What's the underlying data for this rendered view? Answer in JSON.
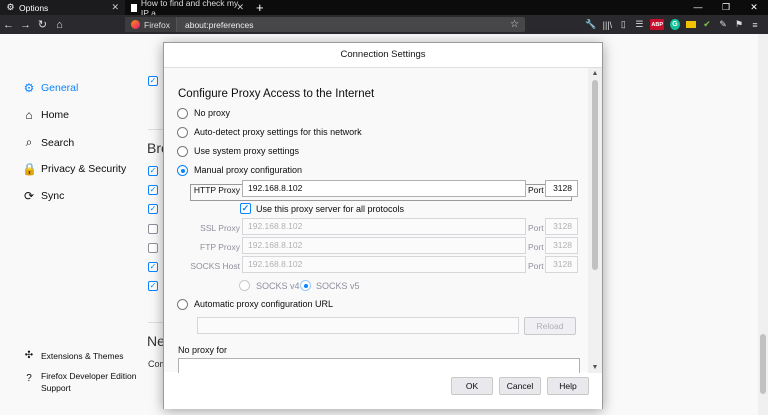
{
  "tabs": [
    {
      "title": "Options",
      "icon": "gear-icon"
    },
    {
      "title": "How to find and check my IP a...",
      "icon": "page-icon"
    }
  ],
  "new_tab": "+",
  "window_controls": [
    "—",
    "❐",
    "✕"
  ],
  "nav": {
    "back": "←",
    "forward": "→",
    "reload": "↻",
    "home": "⌂",
    "identity": "Firefox",
    "url": "about:preferences",
    "star": "☆"
  },
  "toolbar_icons": {
    "abp": "ABP",
    "grammarly": "G"
  },
  "sidebar": {
    "items": [
      {
        "label": "General",
        "icon": "⚙"
      },
      {
        "label": "Home",
        "icon": "⌂"
      },
      {
        "label": "Search",
        "icon": "⌕"
      },
      {
        "label": "Privacy & Security",
        "icon": "🔒"
      },
      {
        "label": "Sync",
        "icon": "⟳"
      }
    ],
    "extensions": "Extensions & Themes",
    "support_line1": "Firefox Developer Edition",
    "support_line2": "Support"
  },
  "background": {
    "heading_partial": "Bro",
    "heading_partial2": "Ne",
    "text_partial": "Com"
  },
  "dialog": {
    "title": "Connection Settings",
    "heading": "Configure Proxy Access to the Internet",
    "options": {
      "no_proxy": "No proxy",
      "auto_detect": "Auto-detect proxy settings for this network",
      "system": "Use system proxy settings",
      "manual": "Manual proxy configuration",
      "auto_url": "Automatic proxy configuration URL"
    },
    "http": {
      "label": "HTTP Proxy",
      "value": "192.168.8.102",
      "port_label": "Port",
      "port": "3128"
    },
    "use_all": "Use this proxy server for all protocols",
    "ssl": {
      "label": "SSL Proxy",
      "value": "192.168.8.102",
      "port_label": "Port",
      "port": "3128"
    },
    "ftp": {
      "label": "FTP Proxy",
      "value": "192.168.8.102",
      "port_label": "Port",
      "port": "3128"
    },
    "socks": {
      "label": "SOCKS Host",
      "value": "192.168.8.102",
      "port_label": "Port",
      "port": "3128"
    },
    "socks_v4": "SOCKS v4",
    "socks_v5": "SOCKS v5",
    "reload": "Reload",
    "no_proxy_for": "No proxy for",
    "ok": "OK",
    "cancel": "Cancel",
    "help": "Help"
  }
}
